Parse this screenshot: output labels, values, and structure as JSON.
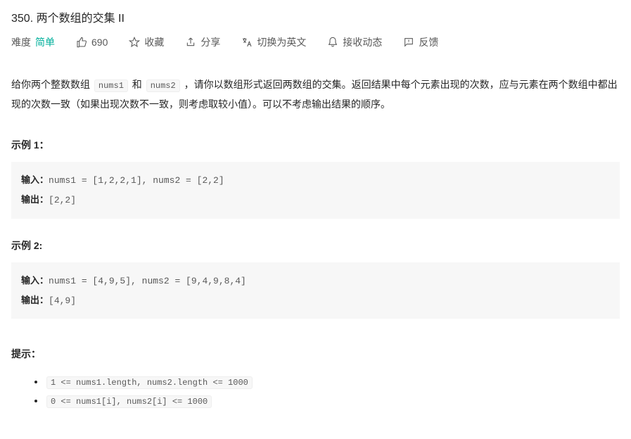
{
  "title": "350. 两个数组的交集 II",
  "meta": {
    "difficultyLabel": "难度",
    "difficultyValue": "简单",
    "likes": "690",
    "favorite": "收藏",
    "share": "分享",
    "switchLang": "切换为英文",
    "subscribe": "接收动态",
    "feedback": "反馈"
  },
  "description": {
    "p1a": "给你两个整数数组 ",
    "c1": "nums1",
    "p1b": " 和 ",
    "c2": "nums2",
    "p1c": " ，请你以数组形式返回两数组的交集。返回结果中每个元素出现的次数，应与元素在两个数组中都出现的次数一致（如果出现次数不一致，则考虑取较小值）。可以不考虑输出结果的顺序。"
  },
  "examples": [
    {
      "head": "示例 1：",
      "inputLabel": "输入：",
      "input": "nums1 = [1,2,2,1], nums2 = [2,2]",
      "outputLabel": "输出：",
      "output": "[2,2]"
    },
    {
      "head": "示例 2:",
      "inputLabel": "输入：",
      "input": "nums1 = [4,9,5], nums2 = [9,4,9,8,4]",
      "outputLabel": "输出：",
      "output": "[4,9]"
    }
  ],
  "hints": {
    "head": "提示：",
    "items": [
      "1 <= nums1.length, nums2.length <= 1000",
      "0 <= nums1[i], nums2[i] <= 1000"
    ]
  }
}
